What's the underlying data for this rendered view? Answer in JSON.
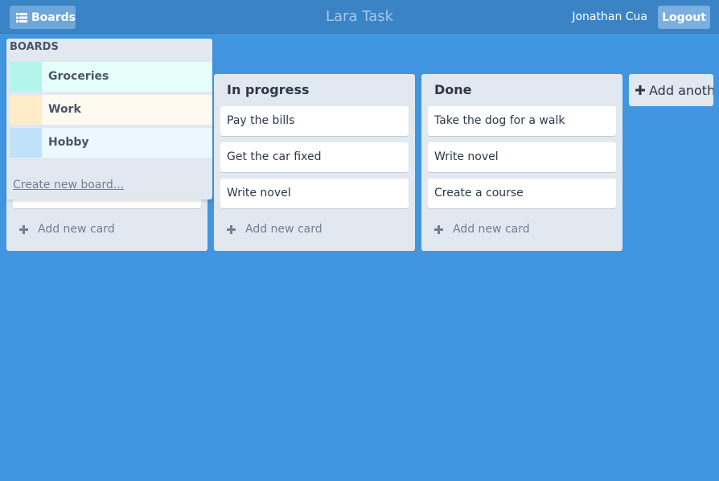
{
  "header": {
    "boards_label": "Boards",
    "app_title": "Lara Task",
    "user_name": "Jonathan Cua",
    "logout_label": "Logout"
  },
  "boards_menu": {
    "heading": "BOARDS",
    "items": [
      {
        "label": "Groceries",
        "color": "#b2f5ea",
        "bg": "#e6fffa"
      },
      {
        "label": "Work",
        "color": "#feebc8",
        "bg": "#fffaf0"
      },
      {
        "label": "Hobby",
        "color": "#bee3f8",
        "bg": "#ebf8ff"
      }
    ],
    "create_label": "Create new board..."
  },
  "lists": [
    {
      "title": "In progress",
      "cards": [
        "Pay the bills",
        "Get the car fixed",
        "Write novel"
      ],
      "add_label": "Add new card"
    },
    {
      "title": "Done",
      "cards": [
        "Take the dog for a walk",
        "Write novel",
        "Create a course"
      ],
      "add_label": "Add new card"
    }
  ],
  "first_list": {
    "add_label": "Add new card"
  },
  "add_list_label": "Add another list",
  "colors": {
    "background": "#4096e1",
    "topbar": "#3a83c4",
    "list_bg": "#e2e8f0"
  },
  "icons": {
    "boards": "list-icon",
    "plus": "plus-icon"
  }
}
